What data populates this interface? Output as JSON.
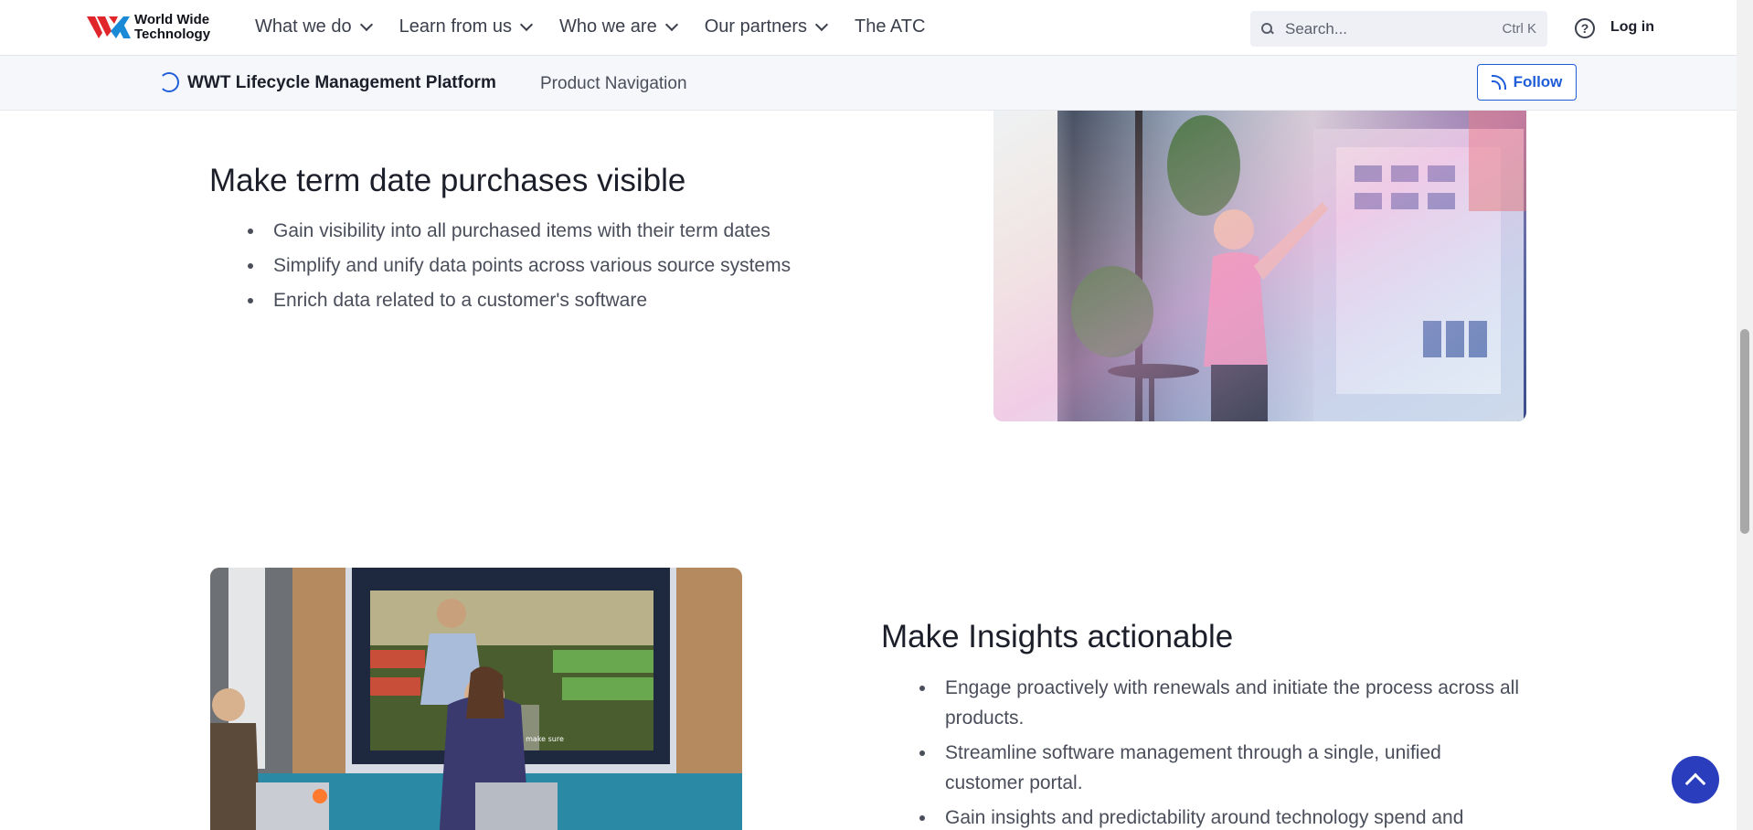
{
  "header": {
    "logo_line1": "World Wide",
    "logo_line2": "Technology",
    "nav": [
      {
        "label": "What we do"
      },
      {
        "label": "Learn from us"
      },
      {
        "label": "Who we are"
      },
      {
        "label": "Our partners"
      },
      {
        "label": "The ATC"
      }
    ],
    "search_placeholder": "Search...",
    "search_shortcut": "Ctrl K",
    "help_glyph": "?",
    "login_label": "Log in"
  },
  "subnav": {
    "title": "WWT Lifecycle Management Platform",
    "product_nav": "Product Navigation",
    "follow_label": "Follow"
  },
  "section1": {
    "title": "Make term date purchases visible",
    "bullets": [
      "Gain visibility into all purchased items with their term dates",
      "Simplify and unify data points across various source systems",
      "Enrich data related to a customer's software"
    ]
  },
  "section2": {
    "title": "Make Insights actionable",
    "bullets": [
      "Engage proactively with renewals and initiate the process across all products.",
      "Streamline software management through a single, unified customer portal.",
      "Gain insights and predictability around technology spend and"
    ],
    "image_caption": "we needed to make sure"
  },
  "colors": {
    "accent": "#1f5ed8",
    "totop": "#2a3ebd",
    "logo_red": "#e0262b",
    "logo_blue": "#1b8ad6"
  }
}
